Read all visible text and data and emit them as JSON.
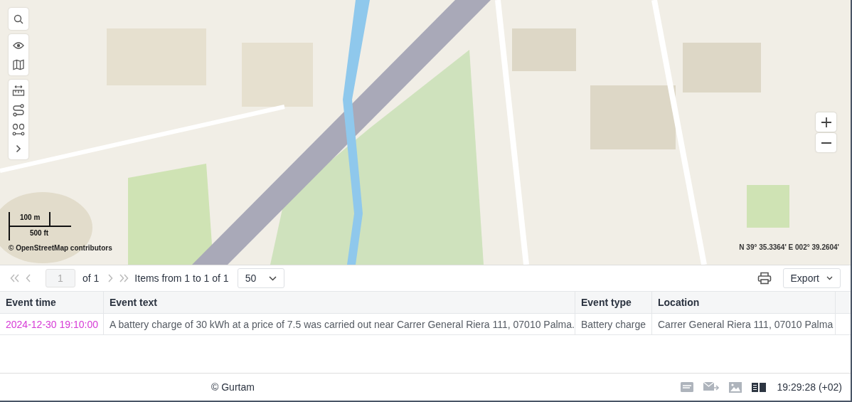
{
  "map": {
    "scale_metric": "100 m",
    "scale_imperial": "500 ft",
    "attribution": "© OpenStreetMap contributors",
    "coordinates": "N 39° 35.3364' E 002° 39.2604'"
  },
  "pager": {
    "page": "1",
    "of": "of 1",
    "items": "Items from 1 to 1 of 1",
    "page_size": "50",
    "export": "Export"
  },
  "table": {
    "columns": [
      "Event time",
      "Event text",
      "Event type",
      "Location"
    ],
    "rows": [
      {
        "cells": [
          "2024-12-30 19:10:00",
          "A battery charge of 30 kWh at a price of 7.5 was carried out near Carrer General Riera 111, 07010 Palma.",
          "Battery charge",
          "Carrer General Riera 111, 07010 Palma"
        ]
      }
    ]
  },
  "footer": {
    "copyright": "© Gurtam",
    "time": "19:29:28 (+02)"
  }
}
